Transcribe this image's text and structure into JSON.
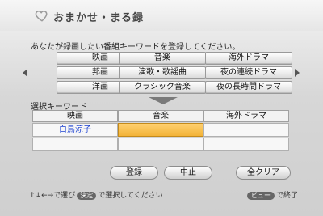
{
  "app": {
    "title": "おまかせ・まる録",
    "icon": "heart-icon"
  },
  "instruction": "あなたが録画したい番組キーワードを登録してください。",
  "keyword_grid": [
    [
      "映画",
      "音楽",
      "海外ドラマ"
    ],
    [
      "邦画",
      "演歌・歌謡曲",
      "夜の連続ドラマ"
    ],
    [
      "洋画",
      "クラシック音楽",
      "夜の長時間ドラマ"
    ]
  ],
  "selected": {
    "label": "選択キーワード",
    "headers": [
      "映画",
      "音楽",
      "海外ドラマ"
    ],
    "rows": [
      [
        "白鳥涼子",
        "",
        ""
      ],
      [
        "",
        "",
        ""
      ]
    ],
    "focused_slot": "row0-col1"
  },
  "buttons": {
    "register": "登録",
    "cancel": "中止",
    "clear_all": "全クリア"
  },
  "footer": {
    "nav_arrows": "↑↓←→",
    "select_text": "で選び",
    "confirm_key": "決定",
    "confirm_text": "で選択してください",
    "view_key": "ビュー",
    "view_text": "で終了"
  },
  "colors": {
    "focus": "#f3b338",
    "selected_text": "#1a3fd0"
  }
}
